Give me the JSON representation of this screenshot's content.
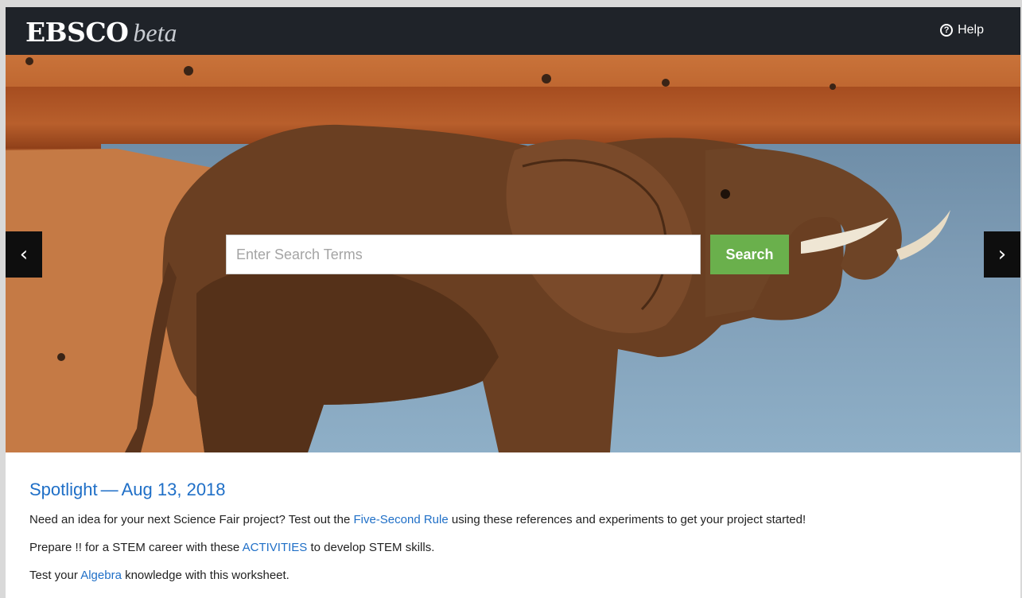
{
  "header": {
    "brand": "EBSCO",
    "brand_suffix": "beta",
    "help_label": "Help",
    "help_icon": "question-circle-icon"
  },
  "hero": {
    "image": "elephant-at-watering-hole",
    "prev_icon": "‹",
    "next_icon": "›"
  },
  "search": {
    "placeholder": "Enter Search Terms",
    "value": "",
    "button_label": "Search"
  },
  "spotlight": {
    "title": "Spotlight",
    "separator": "—",
    "date": "Aug 13, 2018",
    "lines": [
      {
        "pre": "Need an idea for your next Science Fair project? Test out the ",
        "link": "Five-Second Rule",
        "post": " using these references and experiments to get your project started!"
      },
      {
        "pre": "Prepare !! for a STEM career with these ",
        "link": "ACTIVITIES",
        "post": " to develop STEM skills."
      },
      {
        "pre": "Test your ",
        "link": "Algebra",
        "post": " knowledge with this worksheet."
      }
    ]
  },
  "colors": {
    "topbar": "#1f2329",
    "search_button": "#6ab04c",
    "link": "#1f6fc7"
  }
}
